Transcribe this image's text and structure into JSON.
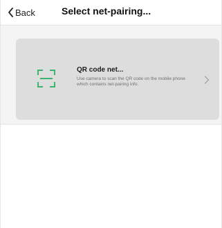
{
  "header": {
    "back_label": "Back",
    "title": "Select net-pairing..."
  },
  "options": [
    {
      "title": "QR code net...",
      "description": "Use camera to scan the QR code on the mobile phone which contains net-pairing info.",
      "icon": "qr-scan-icon",
      "accent_color": "#3cb371"
    }
  ],
  "colors": {
    "section_bg": "#f4f4f4",
    "card_bg": "#dddddd",
    "title_text": "#111111",
    "secondary_text": "#6f6f6f"
  }
}
